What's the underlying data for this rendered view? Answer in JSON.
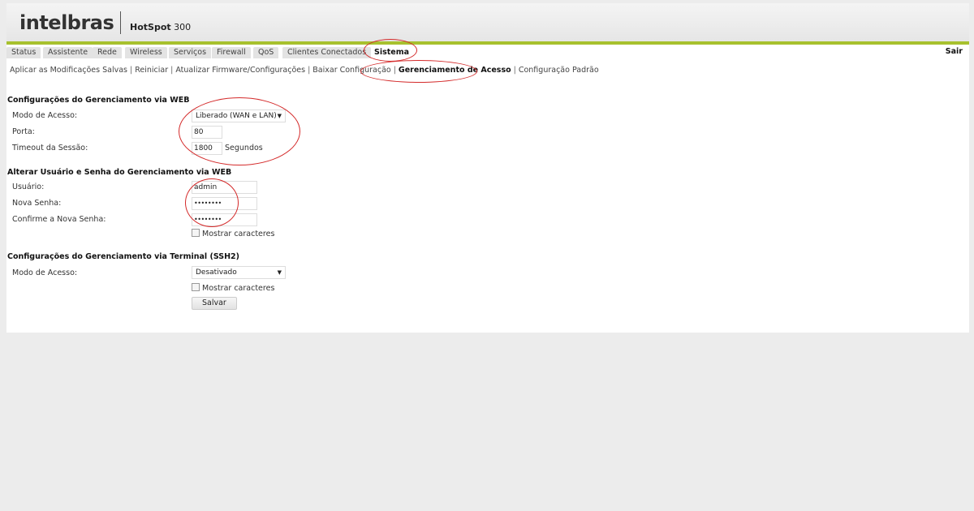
{
  "header": {
    "logo": "intelbras",
    "product_name": "HotSpot",
    "product_model": "300"
  },
  "nav": {
    "items": [
      "Status",
      "Assistente",
      "Rede",
      "Wireless",
      "Serviços",
      "Firewall",
      "QoS",
      "Clientes Conectados",
      "Sistema"
    ],
    "active": "Sistema",
    "logout": "Sair"
  },
  "subnav": {
    "items": [
      "Aplicar as Modificações Salvas",
      "Reiniciar",
      "Atualizar Firmware/Configurações",
      "Baixar Configuração",
      "Gerenciamento de Acesso",
      "Configuração Padrão"
    ],
    "active": "Gerenciamento de Acesso"
  },
  "web_mgmt": {
    "title": "Configurações do Gerenciamento via WEB",
    "access_mode_label": "Modo de Acesso:",
    "access_mode_value": "Liberado (WAN e LAN)",
    "port_label": "Porta:",
    "port_value": "80",
    "timeout_label": "Timeout da Sessão:",
    "timeout_value": "1800",
    "timeout_unit": "Segundos"
  },
  "user_mgmt": {
    "title": "Alterar Usuário e Senha do Gerenciamento via WEB",
    "user_label": "Usuário:",
    "user_value": "admin",
    "new_password_label": "Nova Senha:",
    "new_password_value": "••••••••",
    "confirm_password_label": "Confirme a Nova Senha:",
    "confirm_password_value": "••••••••",
    "show_chars_label": "Mostrar caracteres"
  },
  "ssh_mgmt": {
    "title": "Configurações do Gerenciamento via Terminal (SSH2)",
    "access_mode_label": "Modo de Acesso:",
    "access_mode_value": "Desativado",
    "show_chars_label": "Mostrar caracteres",
    "save_label": "Salvar"
  },
  "colors": {
    "accent_green": "#a7c12e",
    "annotation_red": "#d42a2a"
  }
}
